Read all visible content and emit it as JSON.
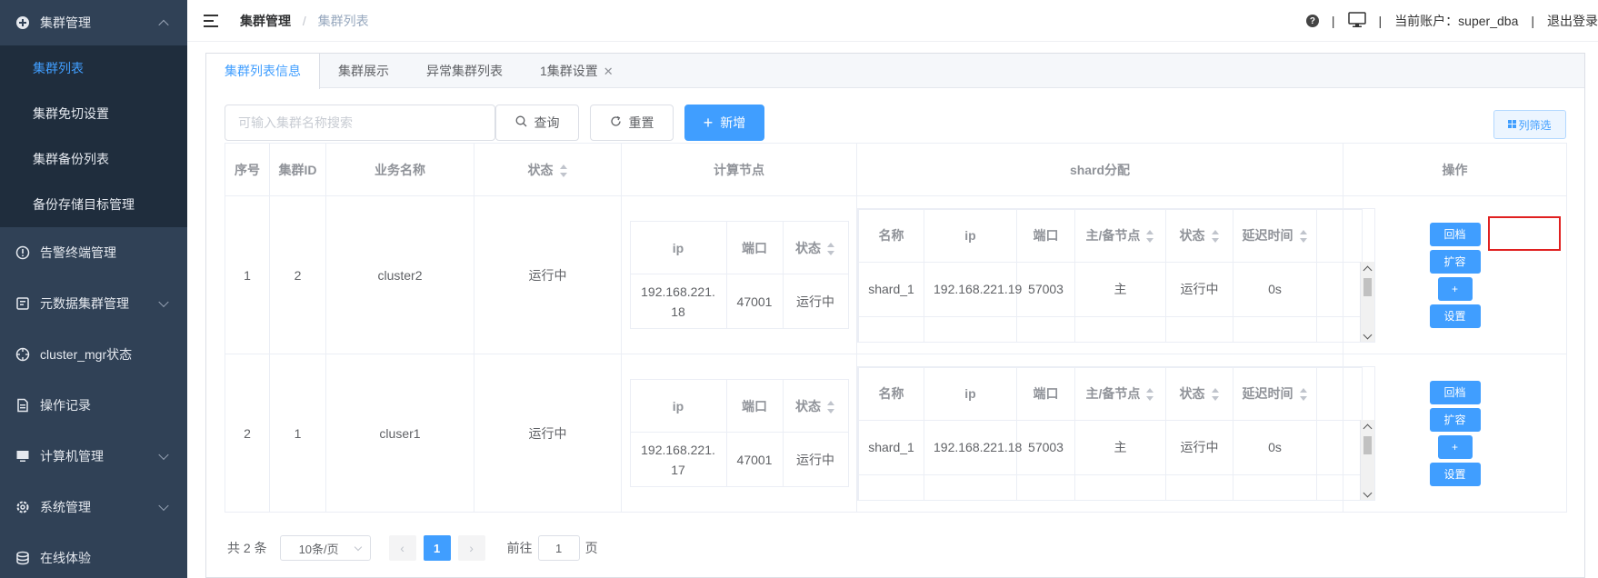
{
  "sidebar": {
    "items": [
      {
        "label": "集群管理",
        "icon": "plus-circle-icon",
        "expanded": true
      },
      {
        "label": "告警终端管理",
        "icon": "alert-circle-icon"
      },
      {
        "label": "元数据集群管理",
        "icon": "database-icon"
      },
      {
        "label": "cluster_mgr状态",
        "icon": "target-icon"
      },
      {
        "label": "操作记录",
        "icon": "document-icon"
      },
      {
        "label": "计算机管理",
        "icon": "monitor-icon"
      },
      {
        "label": "系统管理",
        "icon": "gear-icon"
      },
      {
        "label": "在线体验",
        "icon": "stack-icon"
      }
    ],
    "submenu": [
      "集群列表",
      "集群免切设置",
      "集群备份列表",
      "备份存储目标管理"
    ]
  },
  "header": {
    "breadcrumb": [
      "集群管理",
      "集群列表"
    ],
    "account_label": "当前账户：super_dba",
    "logout": "退出登录",
    "separator": "|"
  },
  "tabs": [
    "集群列表信息",
    "集群展示",
    "异常集群列表",
    "1集群设置"
  ],
  "toolbar": {
    "search_placeholder": "可输入集群名称搜索",
    "query": "查询",
    "reset": "重置",
    "add": "新增",
    "column_filter": "列筛选"
  },
  "table": {
    "headers": [
      "序号",
      "集群ID",
      "业务名称",
      "状态",
      "计算节点",
      "shard分配",
      "操作"
    ],
    "compute_headers": [
      "ip",
      "端口",
      "状态"
    ],
    "shard_headers": [
      "名称",
      "ip",
      "端口",
      "主/备节点",
      "状态",
      "延迟时间"
    ],
    "op_buttons": [
      "回档",
      "扩容",
      "+",
      "设置"
    ],
    "rows": [
      {
        "index": "1",
        "cluster_id": "2",
        "name": "cluster2",
        "status": "运行中",
        "compute": {
          "ip": "192.168.221.18",
          "port": "47001",
          "status": "运行中"
        },
        "shard": {
          "name": "shard_1",
          "ip": "192.168.221.19",
          "port": "57003",
          "role": "主",
          "status": "运行中",
          "delay": "0s"
        }
      },
      {
        "index": "2",
        "cluster_id": "1",
        "name": "cluser1",
        "status": "运行中",
        "compute": {
          "ip": "192.168.221.17",
          "port": "47001",
          "status": "运行中"
        },
        "shard": {
          "name": "shard_1",
          "ip": "192.168.221.18",
          "port": "57003",
          "role": "主",
          "status": "运行中",
          "delay": "0s"
        }
      }
    ]
  },
  "pager": {
    "total": "共 2 条",
    "page_size": "10条/页",
    "current": "1",
    "goto_label": "前往",
    "goto_value": "1",
    "goto_suffix": "页"
  },
  "colors": {
    "sidebar_bg": "#304156",
    "accent": "#409eff",
    "running": "#67c23a",
    "highlight": "#e02020"
  }
}
